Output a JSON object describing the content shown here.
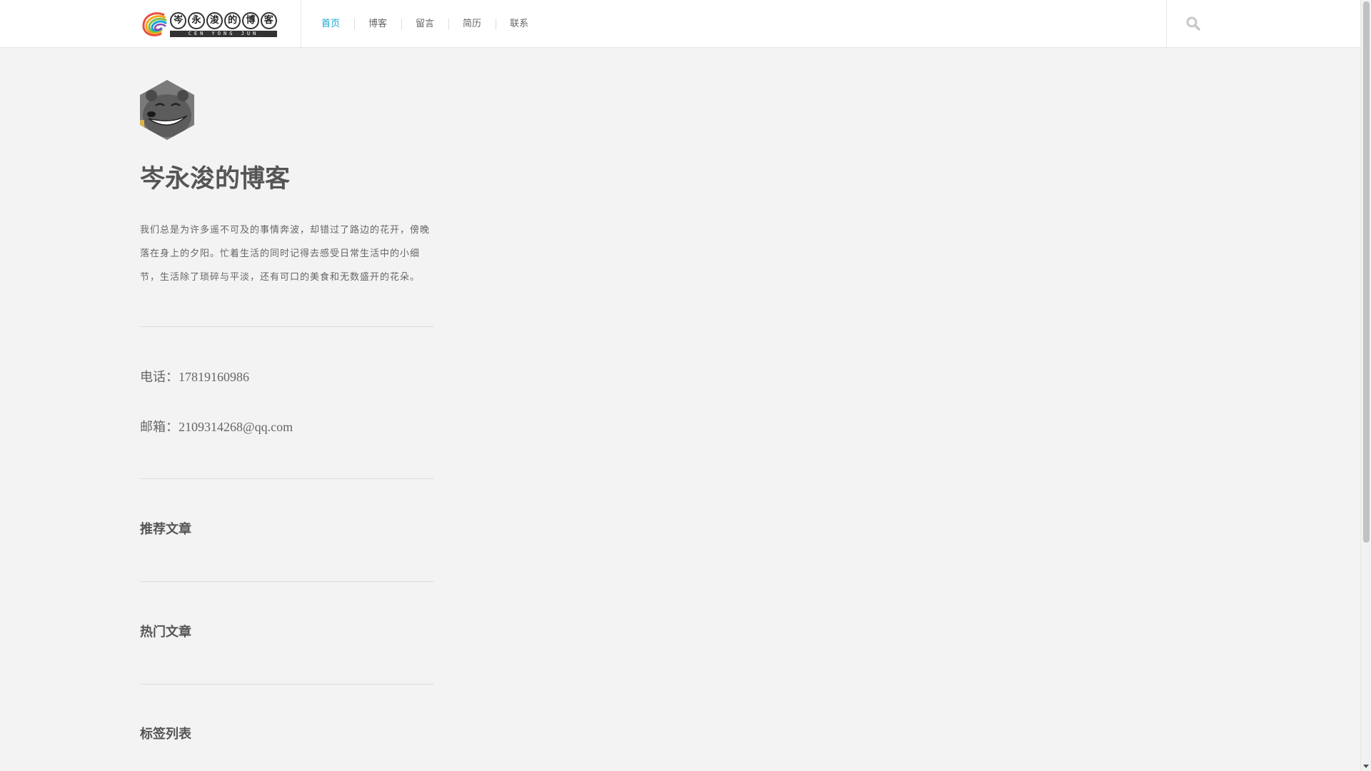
{
  "header": {
    "logo": {
      "characters": [
        "岑",
        "永",
        "浚",
        "的",
        "博",
        "客"
      ],
      "subtitle": "CEN YONG JUN"
    },
    "nav": [
      {
        "label": "首页",
        "active": true
      },
      {
        "label": "博客",
        "active": false
      },
      {
        "label": "留言",
        "active": false
      },
      {
        "label": "简历",
        "active": false
      },
      {
        "label": "联系",
        "active": false
      }
    ],
    "search_icon": "search-icon"
  },
  "sidebar": {
    "avatar_icon": "bear-avatar",
    "title": "岑永浚的博客",
    "description": "我们总是为许多遥不可及的事情奔波，却错过了路边的花开，傍晚落在身上的夕阳。忙着生活的同时记得去感受日常生活中的小细节，生活除了琐碎与平淡，还有可口的美食和无数盛开的花朵。",
    "phone": {
      "label": "电话：",
      "value": "17819160986"
    },
    "email": {
      "label": "邮箱：",
      "value": "2109314268@qq.com"
    },
    "sections": [
      {
        "title": "推荐文章"
      },
      {
        "title": "热门文章"
      },
      {
        "title": "标签列表"
      }
    ]
  },
  "colors": {
    "accent": "#1aa3d6",
    "background": "#f3f3f3",
    "header_bg": "#ffffff",
    "text": "#555555"
  }
}
